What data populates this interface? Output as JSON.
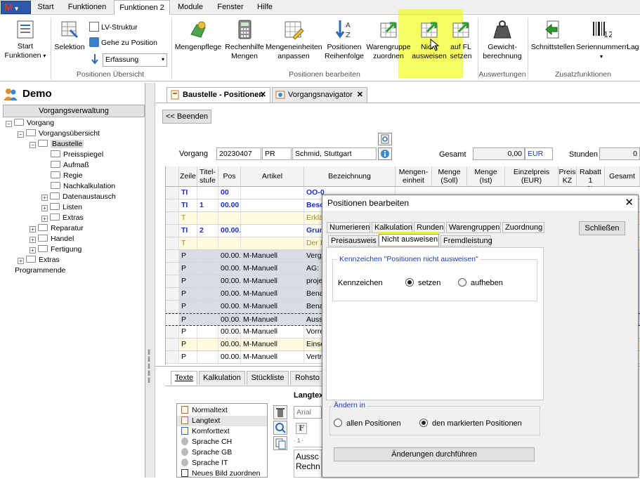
{
  "menubar": {
    "tabs": [
      {
        "label": "Start"
      },
      {
        "label": "Funktionen"
      },
      {
        "label": "Funktionen 2"
      },
      {
        "label": "Module"
      },
      {
        "label": "Fenster"
      },
      {
        "label": "Hilfe"
      }
    ]
  },
  "ribbon": {
    "start_label_1": "Start",
    "start_label_2": "Funktionen",
    "selektion_label": "Selektion",
    "lv_struktur_label": "LV-Struktur",
    "gehe_zu_position_label": "Gehe zu Position",
    "erfassung_value": "Erfassung",
    "group_positionen_uebersicht": "Positionen Übersicht",
    "mengenpflege_label": "Mengenpflege",
    "rechenhilfe_label_1": "Rechenhilfe",
    "rechenhilfe_label_2": "Mengen",
    "mengeneinheiten_label_1": "Mengeneinheiten",
    "mengeneinheiten_label_2": "anpassen",
    "positionen_reihenfolge_label_1": "Positionen",
    "positionen_reihenfolge_label_2": "Reihenfolge",
    "warengruppe_zuordnen_label_1": "Warengruppe",
    "warengruppe_zuordnen_label_2": "zuordnen",
    "nicht_ausweisen_label_1": "Nicht",
    "nicht_ausweisen_label_2": "ausweisen",
    "auf_fl_setzen_label_1": "auf FL",
    "auf_fl_setzen_label_2": "setzen",
    "group_positionen_bearbeiten": "Positionen bearbeiten",
    "gewichtberechnung_label_1": "Gewicht-",
    "gewichtberechnung_label_2": "berechnung",
    "group_auswertungen": "Auswertungen",
    "schnittstellen_label": "Schnittstellen",
    "seriennummern_label": "Seriennummern",
    "lager_label": "Lag",
    "group_zusatzfunktionen": "Zusatzfunktionen"
  },
  "leftpanel": {
    "title": "Demo",
    "vorgangsverwaltung_label": "Vorgangsverwaltung",
    "tree": [
      {
        "label": "Vorgang",
        "level": 0,
        "expander": "−"
      },
      {
        "label": "Vorgangsübersicht",
        "level": 1,
        "expander": "−"
      },
      {
        "label": "Baustelle",
        "level": 2,
        "expander": "−",
        "selected": true
      },
      {
        "label": "Preisspiegel",
        "level": 3,
        "expander": ""
      },
      {
        "label": "Aufmaß",
        "level": 3,
        "expander": ""
      },
      {
        "label": "Regie",
        "level": 3,
        "expander": ""
      },
      {
        "label": "Nachkalkulation",
        "level": 3,
        "expander": ""
      },
      {
        "label": "Datenaustausch",
        "level": 3,
        "expander": "+"
      },
      {
        "label": "Listen",
        "level": 3,
        "expander": "+"
      },
      {
        "label": "Extras",
        "level": 3,
        "expander": "+"
      },
      {
        "label": "Reparatur",
        "level": 2,
        "expander": "+"
      },
      {
        "label": "Handel",
        "level": 2,
        "expander": "+"
      },
      {
        "label": "Fertigung",
        "level": 2,
        "expander": "+"
      },
      {
        "label": "Extras",
        "level": 1,
        "expander": "+"
      },
      {
        "label": "Programmende",
        "level": 0,
        "expander": ""
      }
    ]
  },
  "doc_tabs": {
    "tab1": "Baustelle - Positionen",
    "tab2": "Vorgangsnavigator",
    "close_glyph": "✕"
  },
  "header": {
    "beenden_label": "<< Beenden",
    "vorgang_label": "Vorgang",
    "vorgang_nr": "20230407",
    "vorgang_typ": "PR",
    "vorgang_kunde": "Schmid, Stuttgart",
    "gesamt_label": "Gesamt",
    "gesamt_value": "0,00",
    "currency": "EUR",
    "stunden_label": "Stunden",
    "stunden_value": "0"
  },
  "grid": {
    "headers": {
      "zeile": "Zeile",
      "titelstufe_1": "Titel-",
      "titelstufe_2": "stufe",
      "pos": "Pos",
      "artikel": "Artikel",
      "bezeichnung": "Bezeichnung",
      "mengeneinheit_1": "Mengen-",
      "mengeneinheit_2": "einheit",
      "menge_soll_1": "Menge",
      "menge_soll_2": "(Soll)",
      "menge_ist_1": "Menge",
      "menge_ist_2": "(Ist)",
      "einzelpreis_1": "Einzelpreis",
      "einzelpreis_2": "(EUR)",
      "preiskz_1": "Preis",
      "preiskz_2": "KZ",
      "rabatt_1": "Rabatt 1",
      "rabatt_2": "%",
      "gesamt": "Gesamt"
    },
    "rows": [
      {
        "zeile": "TI",
        "stufe": "",
        "pos": "00",
        "artikel": "",
        "bez": "OO-0",
        "style": "ti"
      },
      {
        "zeile": "TI",
        "stufe": "1",
        "pos": "00.00",
        "artikel": "",
        "bez": "Besc",
        "style": "ti"
      },
      {
        "zeile": "T",
        "stufe": "",
        "pos": "",
        "artikel": "",
        "bez": "Erklä",
        "style": "t"
      },
      {
        "zeile": "TI",
        "stufe": "2",
        "pos": "00.00.",
        "artikel": "",
        "bez": "Grun",
        "style": "ti"
      },
      {
        "zeile": "T",
        "stufe": "",
        "pos": "",
        "artikel": "",
        "bez": "Der B",
        "style": "t"
      },
      {
        "zeile": "P",
        "stufe": "",
        "pos": "00.00.",
        "artikel": "M-Manuell",
        "bez": "Vergi",
        "style": "psel"
      },
      {
        "zeile": "P",
        "stufe": "",
        "pos": "00.00.",
        "artikel": "M-Manuell",
        "bez": "AG: I",
        "style": "psel"
      },
      {
        "zeile": "P",
        "stufe": "",
        "pos": "00.00.",
        "artikel": "M-Manuell",
        "bez": "proje",
        "style": "psel"
      },
      {
        "zeile": "P",
        "stufe": "",
        "pos": "00.00.",
        "artikel": "M-Manuell",
        "bez": "Bena",
        "style": "psel"
      },
      {
        "zeile": "P",
        "stufe": "",
        "pos": "00.00.",
        "artikel": "M-Manuell",
        "bez": "Bena",
        "style": "psel"
      },
      {
        "zeile": "P",
        "stufe": "",
        "pos": "00.00.",
        "artikel": "M-Manuell",
        "bez": "Auss",
        "style": "psel"
      },
      {
        "zeile": "P",
        "stufe": "",
        "pos": "00.00.",
        "artikel": "M-Manuell",
        "bez": "Vorre",
        "style": "p"
      },
      {
        "zeile": "P",
        "stufe": "",
        "pos": "00.00.",
        "artikel": "M-Manuell",
        "bez": "Einsc",
        "style": "p"
      },
      {
        "zeile": "P",
        "stufe": "",
        "pos": "00.00.",
        "artikel": "M-Manuell",
        "bez": "Vertr",
        "style": "p"
      }
    ]
  },
  "lower": {
    "tabs": [
      "Texte",
      "Kalkulation",
      "Stückliste",
      "Rohsto"
    ],
    "langtext_label": "Langtex",
    "text_items": [
      {
        "label": "Normaltext"
      },
      {
        "label": "Langtext"
      },
      {
        "label": "Komforttext"
      },
      {
        "label": "Sprache CH"
      },
      {
        "label": "Sprache GB"
      },
      {
        "label": "Sprache IT"
      },
      {
        "label": "Neues Bild zuordnen"
      }
    ],
    "font_value": "Arial",
    "bold_glyph": "F",
    "text_preview_1": "Aussc",
    "text_preview_2": "Rechn"
  },
  "dialog": {
    "title": "Positionen bearbeiten",
    "close_glyph": "✕",
    "tabs_row1": [
      "Numerieren",
      "Kalkulation",
      "Runden",
      "Warengruppen",
      "Zuordnung"
    ],
    "tabs_row2": [
      "Preisausweis",
      "Nicht ausweisen",
      "Fremdleistung"
    ],
    "schliessen_label": "Schließen",
    "group_title": "Kennzeichen \"Positionen nicht ausweisen\"",
    "kennzeichen_label": "Kennzeichen",
    "opt_setzen": "setzen",
    "opt_aufheben": "aufheben",
    "aendern_in_label": "Ändern in",
    "opt_allen": "allen Positionen",
    "opt_markierten": "den markierten Positionen",
    "apply_label": "Änderungen durchführen"
  }
}
